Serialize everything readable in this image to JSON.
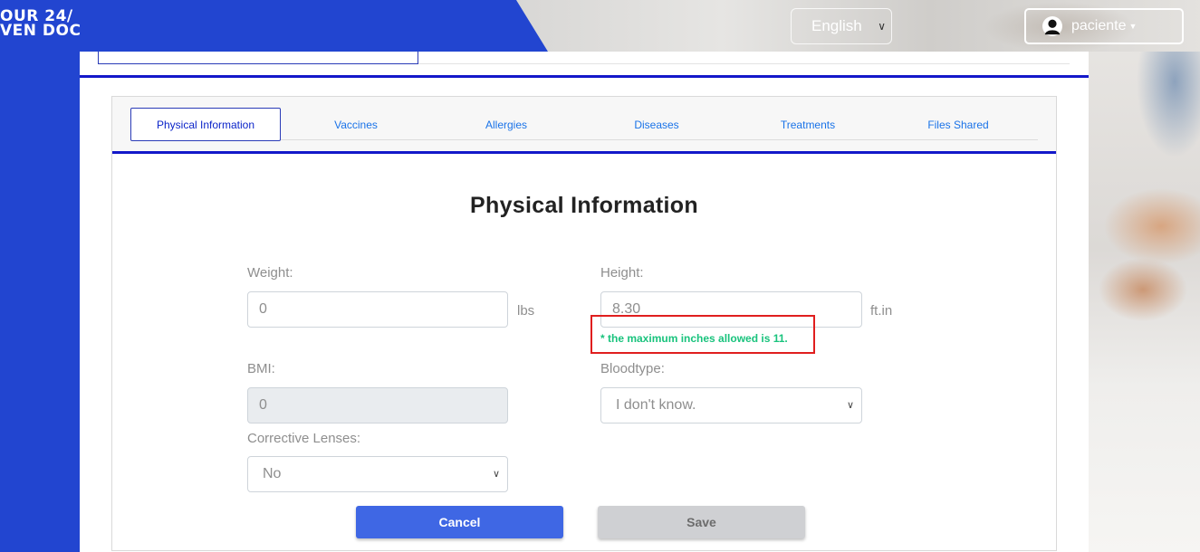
{
  "header": {
    "logo_line1": "OUR 24/",
    "logo_line2": "VEN DOC",
    "language": "English",
    "user": "paciente"
  },
  "tabs": [
    {
      "label": "Physical Information",
      "active": true
    },
    {
      "label": "Vaccines",
      "active": false
    },
    {
      "label": "Allergies",
      "active": false
    },
    {
      "label": "Diseases",
      "active": false
    },
    {
      "label": "Treatments",
      "active": false
    },
    {
      "label": "Files Shared",
      "active": false
    }
  ],
  "section": {
    "title": "Physical Information"
  },
  "form": {
    "weight": {
      "label": "Weight:",
      "value": "0",
      "unit": "lbs"
    },
    "height": {
      "label": "Height:",
      "value": "8.30",
      "unit": "ft.in",
      "error": "* the maximum inches allowed is 11."
    },
    "bmi": {
      "label": "BMI:",
      "value": "0"
    },
    "bloodtype": {
      "label": "Bloodtype:",
      "value": "I don't know."
    },
    "corrective_lenses": {
      "label": "Corrective Lenses:",
      "value": "No"
    }
  },
  "buttons": {
    "cancel": "Cancel",
    "save": "Save"
  },
  "colors": {
    "brand_blue": "#2245d0",
    "accent": "#1318c9",
    "error_border": "#e01e1e",
    "error_text": "#19c37d"
  }
}
